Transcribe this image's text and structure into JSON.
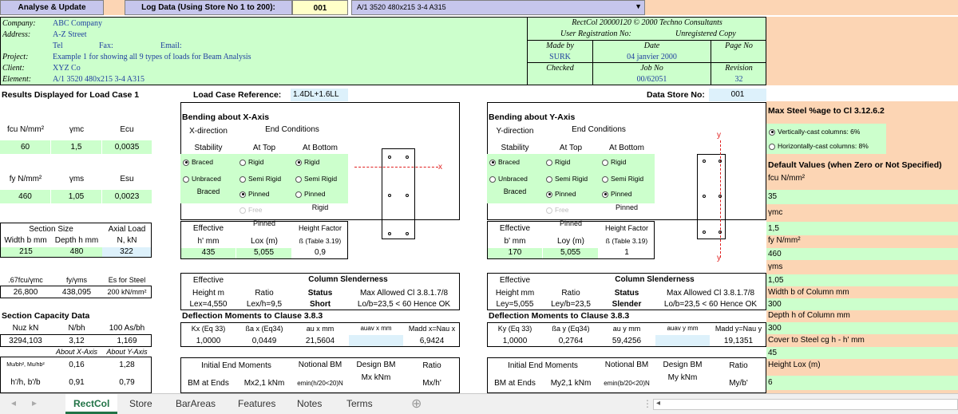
{
  "toolbar": {
    "analyse_button": "Analyse & Update",
    "log_label": "Log Data (Using Store No 1 to 200):",
    "log_value": "001",
    "store_select": "A/1 3520 480x215 3-4 A315",
    "dropdown_arrow": "▼"
  },
  "header": {
    "labels": [
      "Company:",
      "Address:",
      "",
      "Project:",
      "Client:",
      "Element:"
    ],
    "company": "ABC Company",
    "address": "A-Z Street",
    "tel": "Tel",
    "fax": "Fax:",
    "email": "Email:",
    "project": "Example 1 for showing all 9 types of loads for Beam Analysis",
    "client": "XYZ Co",
    "element": "A/1 3520 480x215 3-4 A315",
    "brand": "RectCol 20000120  ©  2000 Techno Consultants",
    "registration_label": "User Registration No:",
    "registration_value": "Unregistered Copy",
    "made_by_label": "Made by",
    "date_label": "Date",
    "page_label": "Page No",
    "made_by": "SURK",
    "date": "04 janvier 2000",
    "checked_label": "Checked",
    "job_label": "Job No",
    "revision_label": "Revision",
    "job": "00/62051",
    "revision": "32"
  },
  "results": {
    "load_case_title": "Results Displayed for Load Case 1",
    "load_case_ref_label": "Load Case Reference:",
    "load_case_ref": "1.4DL+1.6LL",
    "data_store_label": "Data Store No:",
    "data_store": "001"
  },
  "materials": {
    "fcu_label": "fcu N/mm²",
    "gmc_label": "γmc",
    "ecu_label": "Ecu",
    "fcu": "60",
    "gmc": "1,5",
    "ecu": "0,0035",
    "fy_label": "fy N/mm²",
    "gms_label": "γms",
    "esu_label": "Esu",
    "fy": "460",
    "gms": "1,05",
    "esu": "0,0023"
  },
  "section": {
    "size_label": "Section Size",
    "axial_label": "Axial Load",
    "width_label": "Width b mm",
    "depth_label": "Depth h mm",
    "n_label": "N, kN",
    "width": "215",
    "depth": "480",
    "n": "322"
  },
  "derived": {
    "h1": ".67fcu/γmc",
    "h2": "fy/γms",
    "h3": "Es for Steel",
    "v1": "26,800",
    "v2": "438,095",
    "v3": "200 kN/mm²"
  },
  "capacity": {
    "title": "Section Capacity Data",
    "h1": "Nuz kN",
    "h2": "N/bh",
    "h3": "100 As/bh",
    "v1": "3294,103",
    "v2": "3,12",
    "v3": "1,169",
    "about_x": "About X-Axis",
    "about_y": "About Y-Axis",
    "row1_label": "Mu/bh², Mu/hb²",
    "row1_x": "0,16",
    "row1_y": "1,28",
    "row2_label": "h'/h, b'/b",
    "row2_x": "0,91",
    "row2_y": "0,79"
  },
  "bend_x": {
    "title": "Bending about X-Axis",
    "direction": "X-direction",
    "end_conditions": "End Conditions",
    "stability": "Stability",
    "at_top": "At Top",
    "at_bottom": "At Bottom",
    "braced": "Braced",
    "unbraced": "Unbraced",
    "rigid": "Rigid",
    "semi_rigid": "Semi Rigid",
    "pinned": "Pinned",
    "free": "Free",
    "stability_value": "Braced",
    "top_value": "Pinned",
    "bottom_value": "Rigid",
    "effective": "Effective",
    "h_mm": "h' mm",
    "lo_label": "Lox (m)",
    "hf_label": "Height Factor",
    "beta_label": "ß (Table 3.19)",
    "h_value": "435",
    "lo_value": "5,055",
    "beta_value": "0,9",
    "axis_tag": "x",
    "slender_effective": "Effective",
    "slender_title": "Column Slenderness",
    "height_label": "Height m",
    "ratio_label": "Ratio",
    "status_label": "Status",
    "allowed_label": "Max Allowed Cl 3.8.1.7/8",
    "le_value": "Lex=4,550",
    "ratio_value": "Lex/h=9,5",
    "status_value": "Short",
    "allowed_value": "Lo/b=23,5 < 60 Hence OK",
    "defl_title": "Deflection Moments to Clause 3.8.3",
    "k_label": "Kx (Eq 33)",
    "ba_label": "ßa x (Eq34)",
    "au_label": "au x mm",
    "auav_label": "auav x mm",
    "madd_label": "Madd x=Nau x",
    "k_value": "1,0000",
    "ba_value": "0,0449",
    "au_value": "21,5604",
    "madd_value": "6,9424",
    "iem_label": "Initial End Moments",
    "nbm_label": "Notional BM",
    "dbm_label": "Design BM",
    "ratio2_label": "Ratio",
    "bm_ends": "BM at Ends",
    "m2_label": "Mx2,1 kNm",
    "emin_label": "emin(h/20<20)N",
    "mx_label": "Mx  kNm",
    "mxh_label": "Mx/h'"
  },
  "bend_y": {
    "title": "Bending about Y-Axis",
    "direction": "Y-direction",
    "end_conditions": "End Conditions",
    "stability": "Stability",
    "at_top": "At Top",
    "at_bottom": "At Bottom",
    "braced": "Braced",
    "unbraced": "Unbraced",
    "rigid": "Rigid",
    "semi_rigid": "Semi Rigid",
    "pinned": "Pinned",
    "free": "Free",
    "stability_value": "Braced",
    "top_value": "Pinned",
    "bottom_value": "Pinned",
    "effective": "Effective",
    "h_mm": "b' mm",
    "lo_label": "Loy (m)",
    "hf_label": "Height Factor",
    "beta_label": "ß (Table 3.19)",
    "h_value": "170",
    "lo_value": "5,055",
    "beta_value": "1",
    "axis_tag": "y",
    "slender_effective": "Effective",
    "slender_title": "Column Slenderness",
    "height_label": "Height mm",
    "ratio_label": "Ratio",
    "status_label": "Status",
    "allowed_label": "Max Allowed Cl 3.8.1.7/8",
    "le_value": "Ley=5,055",
    "ratio_value": "Ley/b=23,5",
    "status_value": "Slender",
    "allowed_value": "Lo/b=23,5 < 60 Hence OK",
    "defl_title": "Deflection Moments to Clause 3.8.3",
    "k_label": "Ky (Eq 33)",
    "ba_label": "ßa y (Eq34)",
    "au_label": "au y mm",
    "auav_label": "auav y mm",
    "madd_label": "Madd y=Nau y",
    "k_value": "1,0000",
    "ba_value": "0,2764",
    "au_value": "59,4256",
    "madd_value": "19,1351",
    "iem_label": "Initial End Moments",
    "nbm_label": "Notional BM",
    "dbm_label": "Design BM",
    "ratio2_label": "Ratio",
    "bm_ends": "BM at Ends",
    "m2_label": "My2,1 kNm",
    "emin_label": "emin(b/20<20)N",
    "mx_label": "My  kNm",
    "mxh_label": "My/b'"
  },
  "right_panel": {
    "max_steel_title": "Max Steel %age to Cl 3.12.6.2",
    "vertical": "Vertically-cast columns: 6%",
    "horizontal": "Horizontally-cast columns: 8%",
    "defaults_title": "Default Values (when Zero or Not Specified)",
    "rows": [
      {
        "label": "fcu N/mm²",
        "value": "35"
      },
      {
        "label": "γmc",
        "value": "1,5"
      },
      {
        "label": "fy N/mm²",
        "value": "460"
      },
      {
        "label": "γms",
        "value": "1,05"
      },
      {
        "label": "Width b of Column mm",
        "value": "300"
      },
      {
        "label": "Depth h of Column mm",
        "value": "300"
      },
      {
        "label": "Cover to Steel cg h - h' mm",
        "value": "45"
      },
      {
        "label": "Height Lox (m)",
        "value": "6"
      }
    ]
  },
  "sheet_tabs": [
    "RectCol",
    "Store",
    "BarAreas",
    "Features",
    "Notes",
    "Terms"
  ],
  "add_sheet": "⊕"
}
